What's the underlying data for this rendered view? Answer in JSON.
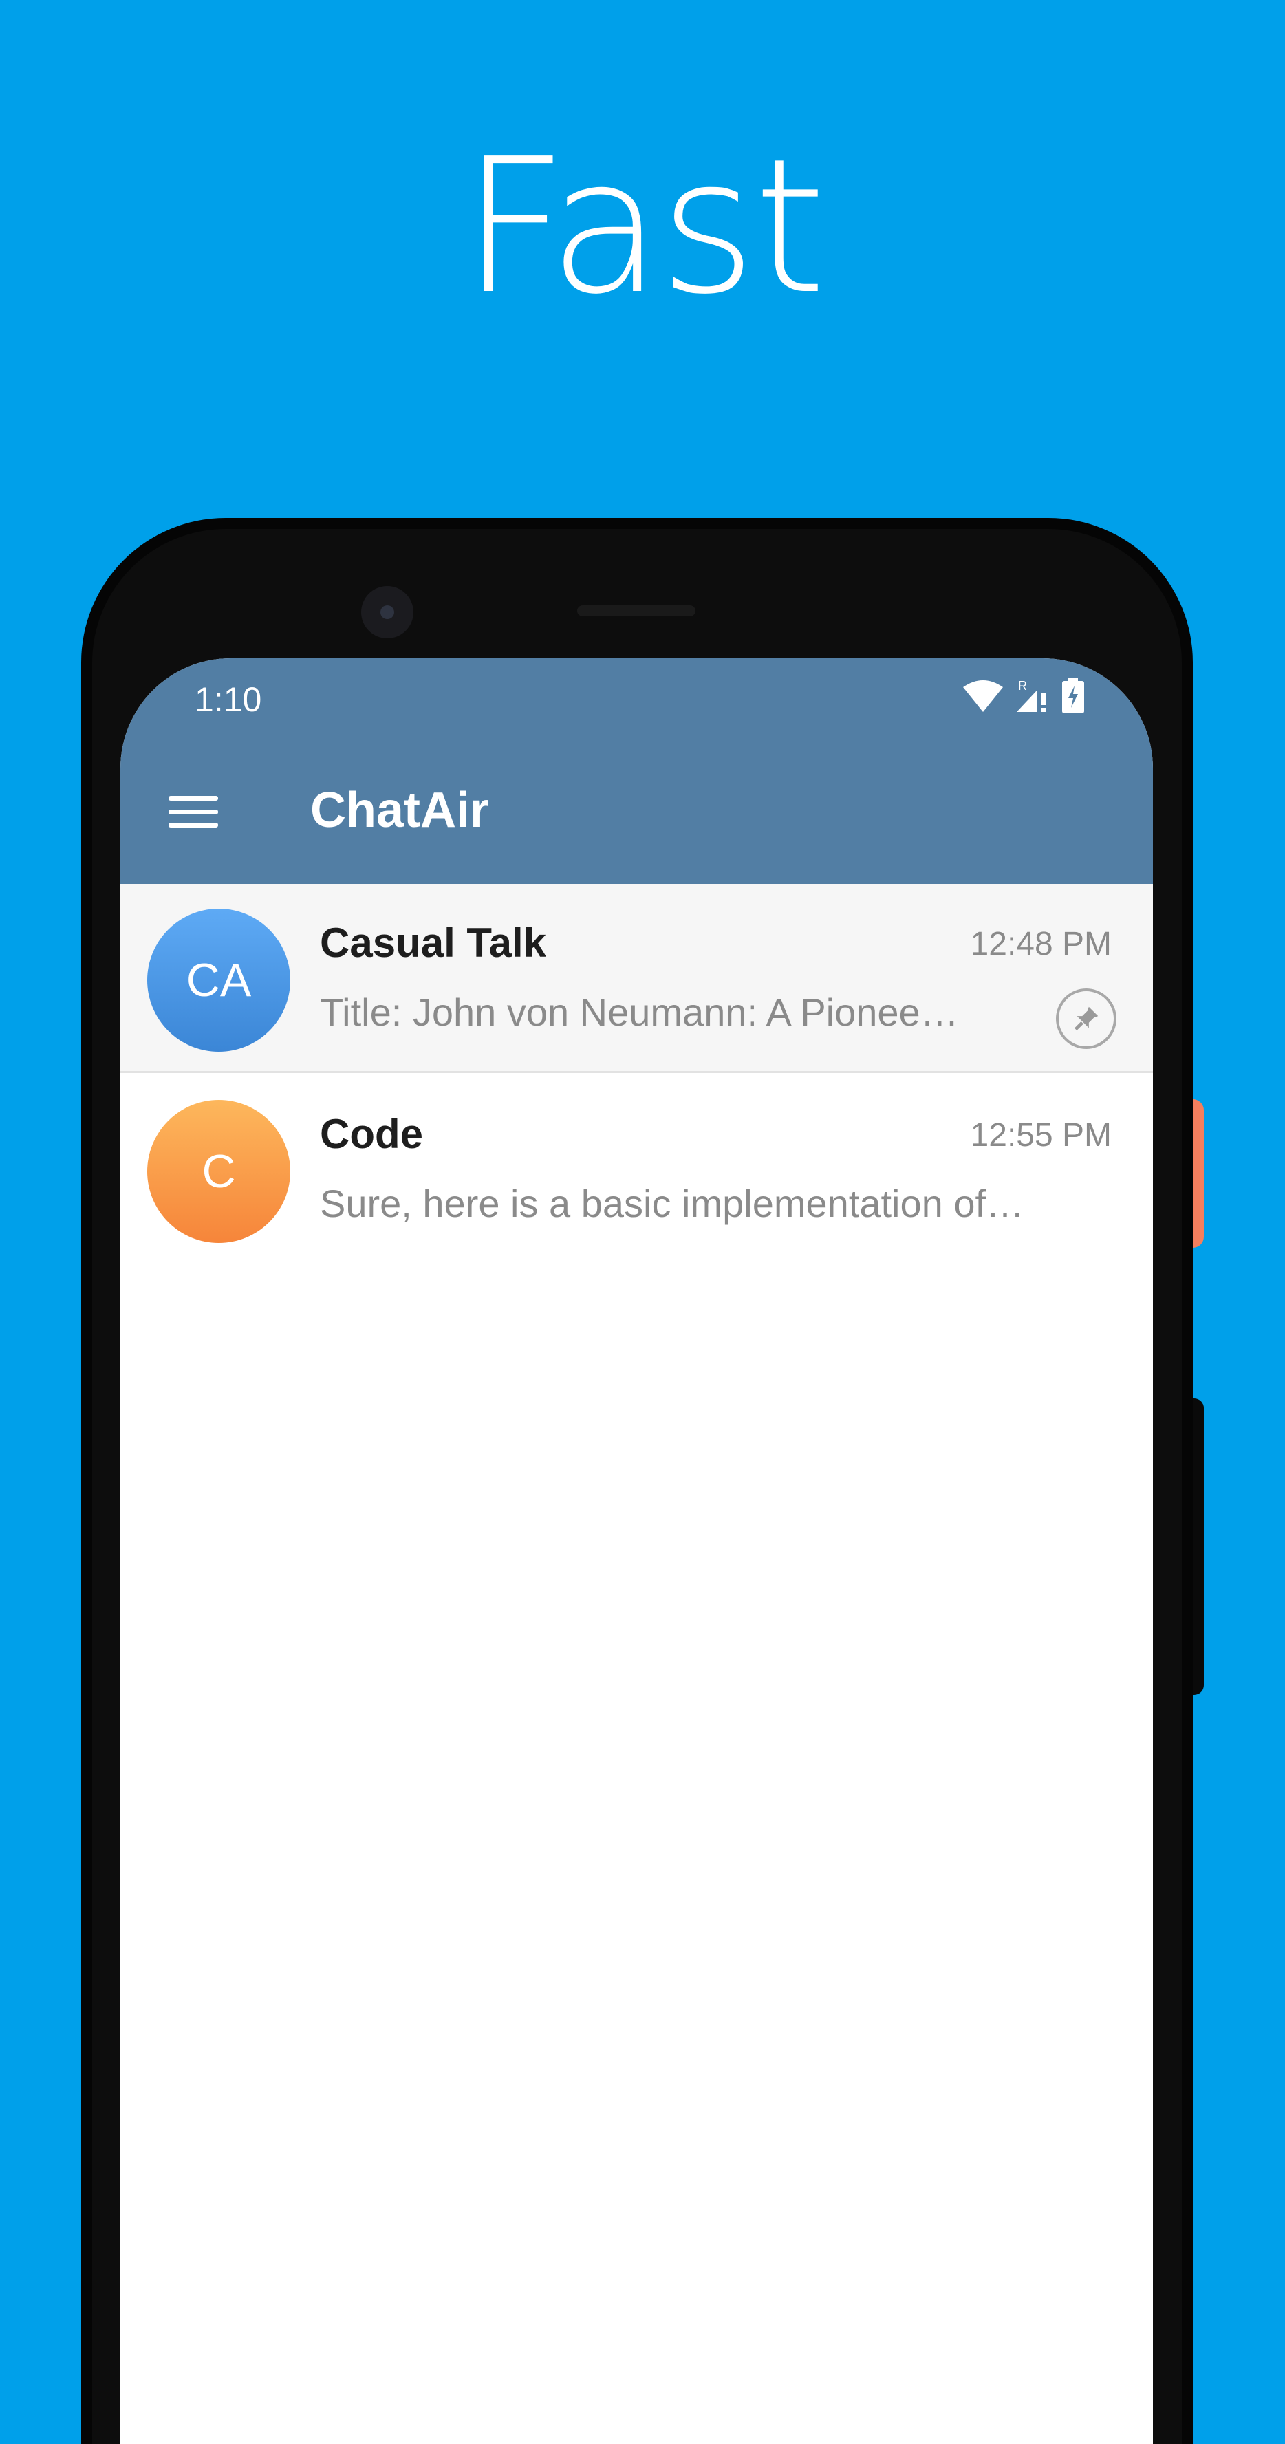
{
  "headline": "Fast",
  "status_bar": {
    "time": "1:10",
    "icons": [
      "wifi-icon",
      "signal-roaming-icon",
      "battery-charging-icon"
    ],
    "roaming_label": "R"
  },
  "app_bar": {
    "title": "ChatAir",
    "menu_icon": "hamburger-icon",
    "color": "#527ea4"
  },
  "chats": [
    {
      "avatar_initials": "CA",
      "title": "Casual Talk",
      "time": "12:48 PM",
      "preview": "Title: John von Neumann: A Pionee…",
      "pinned": true,
      "avatar_color": "#4a97e6"
    },
    {
      "avatar_initials": "C",
      "title": "Code",
      "time": "12:55 PM",
      "preview": "Sure, here is a basic implementation of…",
      "pinned": false,
      "avatar_color": "#f99d4b"
    }
  ],
  "colors": {
    "background": "#00a0ea",
    "side_button": "#f47f5e"
  }
}
